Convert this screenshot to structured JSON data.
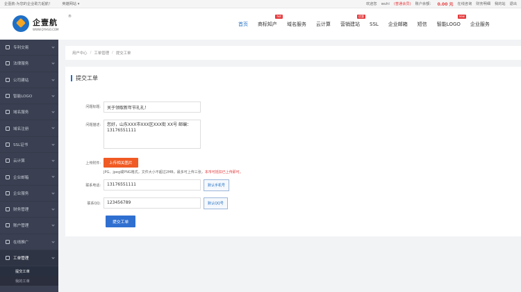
{
  "topbar": {
    "slogan": "企壹航-为您的企业助力起航！",
    "city": "英雄网站 ▾",
    "welcome": "欢迎您",
    "user": "wuhi",
    "user_level": "(普通会员)",
    "balance_label": "账户余额：",
    "balance": "0.00 元",
    "links": [
      "在线咨询",
      "财务明细",
      "我的站",
      "退出"
    ]
  },
  "logo": {
    "name": "企壹航",
    "url": "WWW.QYHSO.COM",
    "reg": "®"
  },
  "nav": {
    "items": [
      {
        "label": "首页",
        "badge": ""
      },
      {
        "label": "商标知产",
        "badge": "hot"
      },
      {
        "label": "域名服务",
        "badge": ""
      },
      {
        "label": "云计算",
        "badge": ""
      },
      {
        "label": "营销建站",
        "badge": "优惠"
      },
      {
        "label": "SSL",
        "badge": ""
      },
      {
        "label": "企业邮箱",
        "badge": ""
      },
      {
        "label": "短信",
        "badge": ""
      },
      {
        "label": "智能LOGO",
        "badge": "new"
      },
      {
        "label": "企业服务",
        "badge": ""
      }
    ]
  },
  "sidebar": {
    "items": [
      {
        "label": "专利交易",
        "icon": "patent-icon"
      },
      {
        "label": "法律服务",
        "icon": "legal-icon"
      },
      {
        "label": "公司建站",
        "icon": "site-icon"
      },
      {
        "label": "智能LOGO",
        "icon": "logo-icon"
      },
      {
        "label": "域名服务",
        "icon": "domain-icon"
      },
      {
        "label": "域名注册",
        "icon": "register-icon"
      },
      {
        "label": "SSL证书",
        "icon": "ssl-icon"
      },
      {
        "label": "云计算",
        "icon": "cloud-icon"
      },
      {
        "label": "企业邮箱",
        "icon": "mail-icon"
      },
      {
        "label": "企业服务",
        "icon": "service-icon"
      },
      {
        "label": "财务管理",
        "icon": "finance-icon"
      },
      {
        "label": "账户管理",
        "icon": "account-icon"
      },
      {
        "label": "在线推广",
        "icon": "promote-icon"
      },
      {
        "label": "工单管理",
        "icon": "ticket-icon"
      }
    ],
    "sub_items": [
      "提交工单",
      "我的工单"
    ]
  },
  "breadcrumb": {
    "items": [
      "用户中心",
      "工单管理",
      "提交工单"
    ],
    "sep": "/"
  },
  "form": {
    "title": "提交工单",
    "title_label": "问题标题:",
    "title_value": "关于领取新年节礼礼！",
    "desc_label": "问题描述:",
    "desc_value": "您好，山东XXX市XXX区XXX街 XX号 邮编：\n13176551111",
    "attach_label": "上传附件:",
    "upload_btn": "上传相关图片",
    "hint_text": "JPG、jpeg或PNG格式，文件大小不超过2MB，最多可上传三张，",
    "hint_warn": "本市可抵扣已上传即可。",
    "phone_label": "联系电话:",
    "phone_value": "13176551111",
    "phone_btn": "默认手机号",
    "qq_label": "联系QQ:",
    "qq_value": "123456789",
    "qq_btn": "默认QQ号",
    "submit": "提交工单"
  }
}
